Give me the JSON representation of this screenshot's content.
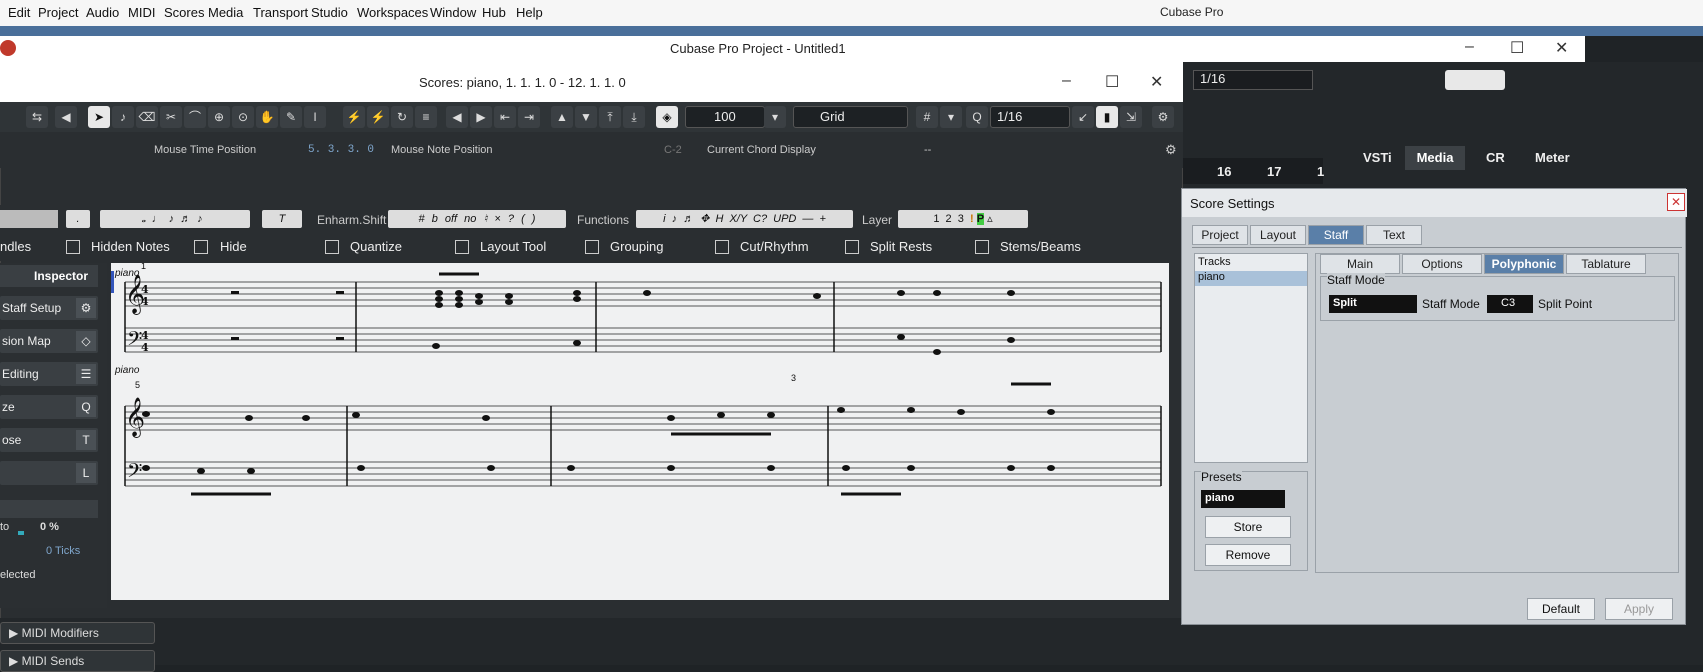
{
  "menu": [
    "Edit",
    "Project",
    "Audio",
    "MIDI",
    "Scores",
    "Media",
    "Transport",
    "Studio",
    "Workspaces",
    "Window",
    "Hub",
    "Help"
  ],
  "app_title": "Cubase Pro",
  "project_title": "Cubase Pro Project - Untitled1",
  "score_title": "Scores: piano, 1. 1. 1.  0 - 12. 1. 1.  0",
  "toolbar": {
    "velocity": "100",
    "snap_mode": "Grid",
    "quantize": "1/16",
    "right_quantize": "1/16"
  },
  "infoline": {
    "mouse_time_label": "Mouse Time Position",
    "mouse_time_value": "5. 3. 3.  0",
    "mouse_note_label": "Mouse Note Position",
    "mouse_note_value": "C-2",
    "chord_label": "Current Chord Display",
    "chord_value": "--"
  },
  "symbols": {
    "t_label": "T",
    "enharm": "Enharm.Shift",
    "functions": "Functions",
    "layer": "Layer",
    "enharm_items": [
      "#",
      "b",
      "off",
      "no",
      "♮",
      "×",
      "?",
      "( )"
    ],
    "func_items": [
      "i",
      "♪",
      "♬",
      "✥",
      "H",
      "X/Y",
      "C?",
      "UPD",
      "—",
      "+"
    ],
    "layer_items": [
      "1",
      "2",
      "3",
      "!",
      "P",
      "▵"
    ]
  },
  "filters": [
    "ndles",
    "Hidden Notes",
    "Hide",
    "Quantize",
    "Layout Tool",
    "Grouping",
    "Cut/Rhythm",
    "Split Rests",
    "Stems/Beams"
  ],
  "inspector": {
    "tab": "Inspector",
    "items": [
      "Staff Setup",
      "sion Map",
      "Editing",
      "ze",
      "ose",
      ""
    ],
    "auto_label": "to",
    "auto_value": "0 %",
    "ticks": "0 Ticks",
    "selected": "elected"
  },
  "score": {
    "track_label_1": "piano",
    "track_label_2": "piano",
    "bar1": "1",
    "bar5": "5",
    "tuplet": "3"
  },
  "bottom": {
    "midi_modifiers": "MIDI Modifiers",
    "midi_sends": "MIDI Sends"
  },
  "right_panel": {
    "tabs": [
      "VSTi",
      "Media",
      "CR",
      "Meter"
    ],
    "bars": [
      "16",
      "17",
      "1"
    ]
  },
  "score_settings": {
    "title": "Score Settings",
    "tabs": [
      "Project",
      "Layout",
      "Staff",
      "Text"
    ],
    "subtabs": [
      "Main",
      "Options",
      "Polyphonic",
      "Tablature"
    ],
    "tracks_label": "Tracks",
    "track": "piano",
    "group": "Staff Mode",
    "mode_value": "Split",
    "mode_label": "Staff Mode",
    "split_value": "C3",
    "split_label": "Split Point",
    "presets_label": "Presets",
    "preset": "piano",
    "store": "Store",
    "remove": "Remove",
    "default": "Default",
    "apply": "Apply"
  }
}
